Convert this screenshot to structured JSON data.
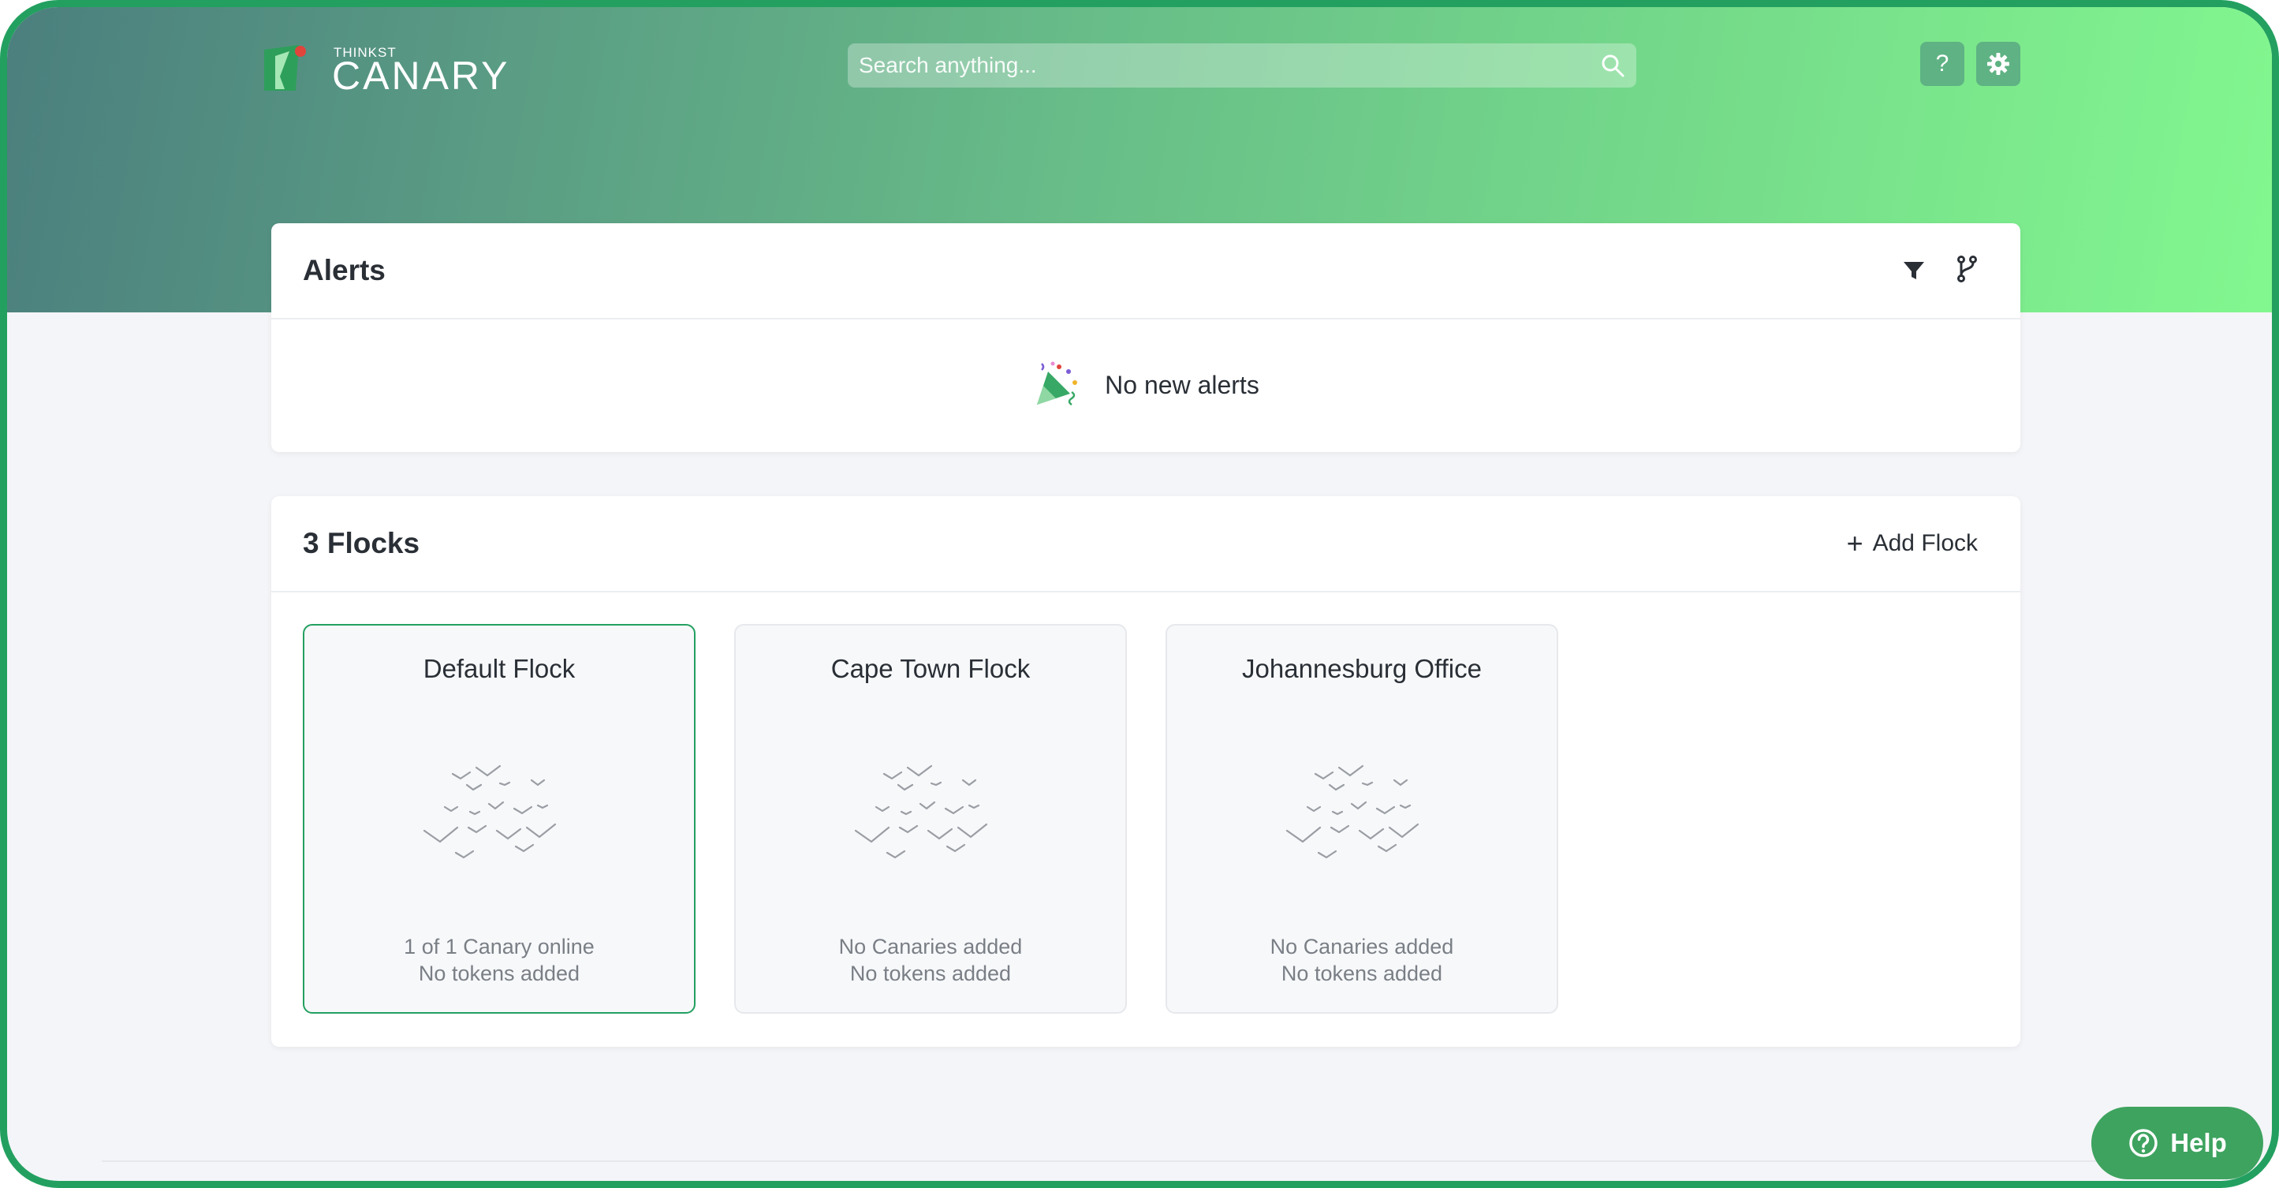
{
  "header": {
    "logo_small": "THINKST",
    "logo_big": "CANARY",
    "search_placeholder": "Search anything...",
    "help_button_label": "?"
  },
  "alerts": {
    "title": "Alerts",
    "empty_message": "No new alerts"
  },
  "flocks": {
    "title": "3 Flocks",
    "add_label": "Add Flock",
    "items": [
      {
        "name": "Default Flock",
        "line1": "1 of 1 Canary online",
        "line2": "No tokens added",
        "selected": true
      },
      {
        "name": "Cape Town Flock",
        "line1": "No Canaries added",
        "line2": "No tokens added",
        "selected": false
      },
      {
        "name": "Johannesburg Office",
        "line1": "No Canaries added",
        "line2": "No tokens added",
        "selected": false
      }
    ]
  },
  "help_widget": {
    "label": "Help"
  },
  "colors": {
    "accent": "#23a060",
    "help_button": "#3ea35f",
    "gradient_start": "#4b7f7e",
    "gradient_end": "#82f78f"
  }
}
